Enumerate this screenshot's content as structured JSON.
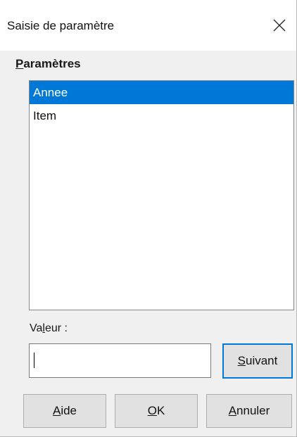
{
  "window": {
    "title": "Saisie de paramètre",
    "close_icon": "close-icon"
  },
  "parameters": {
    "label_mnemonic": "P",
    "label_rest": "aramètres",
    "items": [
      {
        "label": "Annee",
        "selected": true
      },
      {
        "label": "Item",
        "selected": false
      }
    ]
  },
  "value": {
    "label_before": "Va",
    "label_mnemonic": "l",
    "label_after": "eur :",
    "input_value": ""
  },
  "buttons": {
    "next": {
      "mnemonic": "S",
      "rest": "uivant"
    },
    "help": {
      "mnemonic": "A",
      "rest": "ide"
    },
    "ok": {
      "mnemonic": "O",
      "rest": "K"
    },
    "cancel": {
      "mnemonic": "A",
      "rest": "nnuler"
    }
  },
  "colors": {
    "selection": "#0078d7",
    "dialog_bg": "#f0f0f0",
    "title_bg": "#ffffff"
  }
}
